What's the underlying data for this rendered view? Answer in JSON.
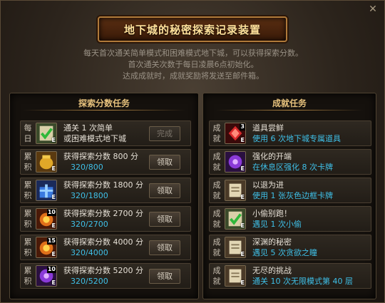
{
  "window": {
    "title": "地下城的秘密探索记录装置",
    "close_icon": "close-icon",
    "description_lines": [
      "每天首次通关简单模式和困难模式地下城，可以获得探索分数。",
      "首次通关次数于每日凌晨6点初始化。",
      "达成成就时，成就奖励将发送至邮件箱。"
    ]
  },
  "left_panel": {
    "title": "探索分数任务",
    "rows": [
      {
        "type": "每\n日",
        "icon": "check-scroll-icon",
        "title": "通关 1 次简单",
        "title2": "或困难模式地下城",
        "progress": "",
        "button": "完成",
        "done": true,
        "badge": ""
      },
      {
        "type": "累\n积",
        "icon": "gold-jar-icon",
        "title": "获得探索分数 800 分",
        "progress": "320/800",
        "button": "领取",
        "done": false,
        "badge": ""
      },
      {
        "type": "累\n积",
        "icon": "blue-gift-icon",
        "title": "获得探索分数 1800 分",
        "progress": "320/1800",
        "button": "领取",
        "done": false,
        "badge": ""
      },
      {
        "type": "累\n积",
        "icon": "fire-orb-icon",
        "title": "获得探索分数 2700 分",
        "progress": "320/2700",
        "button": "领取",
        "done": false,
        "badge": "10"
      },
      {
        "type": "累\n积",
        "icon": "fire-orb-icon",
        "title": "获得探索分数 4000 分",
        "progress": "320/4000",
        "button": "领取",
        "done": false,
        "badge": "15"
      },
      {
        "type": "累\n积",
        "icon": "purple-orb-icon",
        "title": "获得探索分数 5200 分",
        "progress": "320/5200",
        "button": "领取",
        "done": false,
        "badge": "10"
      }
    ]
  },
  "right_panel": {
    "title": "成就任务",
    "rows": [
      {
        "type": "成\n就",
        "icon": "red-gem-icon",
        "title": "道具尝鲜",
        "desc": "使用 6 次地下城专属道具",
        "badge": "3"
      },
      {
        "type": "成\n就",
        "icon": "purple-orb-icon",
        "title": "强化的开端",
        "desc": "在休息区强化 8 次卡牌",
        "badge": ""
      },
      {
        "type": "成\n就",
        "icon": "scroll-card-icon",
        "title": "以退为进",
        "desc": "使用 1 张灰色边框卡牌",
        "badge": ""
      },
      {
        "type": "成\n就",
        "icon": "check-scroll-icon",
        "title": "小偷别跑！",
        "desc": "遇见 1 次小偷",
        "badge": ""
      },
      {
        "type": "成\n就",
        "icon": "scroll-card-icon",
        "title": "深渊的秘密",
        "desc": "遇见 5 次贪欲之瞳",
        "badge": ""
      },
      {
        "type": "成\n就",
        "icon": "scroll-card-icon",
        "title": "无尽的挑战",
        "desc": "通关 10 次无限模式第 40 层",
        "badge": ""
      }
    ]
  },
  "colors": {
    "accent_title": "#ffe09a",
    "progress": "#3fc0e8",
    "panel_title": "#e7c27d"
  }
}
